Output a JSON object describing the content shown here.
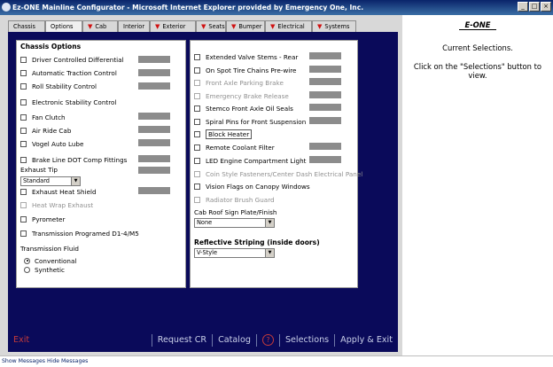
{
  "window": {
    "title": "Ez-ONE Mainline Configurator - Microsoft Internet Explorer provided by Emergency One, Inc.",
    "min": "_",
    "max": "□",
    "close": "×"
  },
  "tabs": [
    "Chassis",
    "Options",
    "Cab",
    "Interior",
    "Exterior",
    "Seats",
    "Bumper",
    "Electrical",
    "Systems"
  ],
  "left_panel": {
    "header": "Chassis Options",
    "items": [
      "Driver Controlled Differential",
      "Automatic Traction Control",
      "Roll Stability Control",
      "Electronic Stability Control",
      "Fan Clutch",
      "Air Ride Cab",
      "Vogel Auto Lube",
      "Brake Line DOT Comp Fittings"
    ],
    "exhaust_tip": {
      "label": "Exhaust Tip",
      "value": "Standard"
    },
    "items2": [
      "Exhaust Heat Shield",
      "Heat Wrap Exhaust",
      "Pyrometer",
      "Transmission Programed D1-4/M5"
    ],
    "transmission_fluid": {
      "label": "Transmission Fluid",
      "options": [
        "Conventional",
        "Synthetic"
      ]
    }
  },
  "right_panel": {
    "items": [
      "Extended Valve Stems - Rear",
      "On Spot Tire Chains Pre-wire",
      "Front Axle Parking Brake",
      "Emergency Brake Release",
      "Stemco Front Axle Oil Seals",
      "Spiral Pins for Front Suspension",
      "Block Heater",
      "Remote Coolant Filter",
      "LED Engine Compartment Light",
      "Coin Style Fasteners/Center Dash Electrical Panel",
      "Vision Flags on Canopy Windows",
      "Radiator Brush Guard"
    ],
    "cab_roof": {
      "label": "Cab Roof Sign Plate/Finish",
      "value": "None"
    },
    "striping": {
      "label": "Reflective Striping (inside doors)",
      "value": "V-Style"
    }
  },
  "bottom_bar": {
    "exit": "Exit",
    "request": "Request CR",
    "catalog": "Catalog",
    "help": "?",
    "selections": "Selections",
    "apply_exit": "Apply & Exit"
  },
  "sidebar": {
    "logo": "E-ONE",
    "heading": "Current Selections.",
    "message": "Click on the \"Selections\" button to view."
  },
  "status": {
    "show": "Show Messages",
    "hide": "Hide Messages"
  }
}
